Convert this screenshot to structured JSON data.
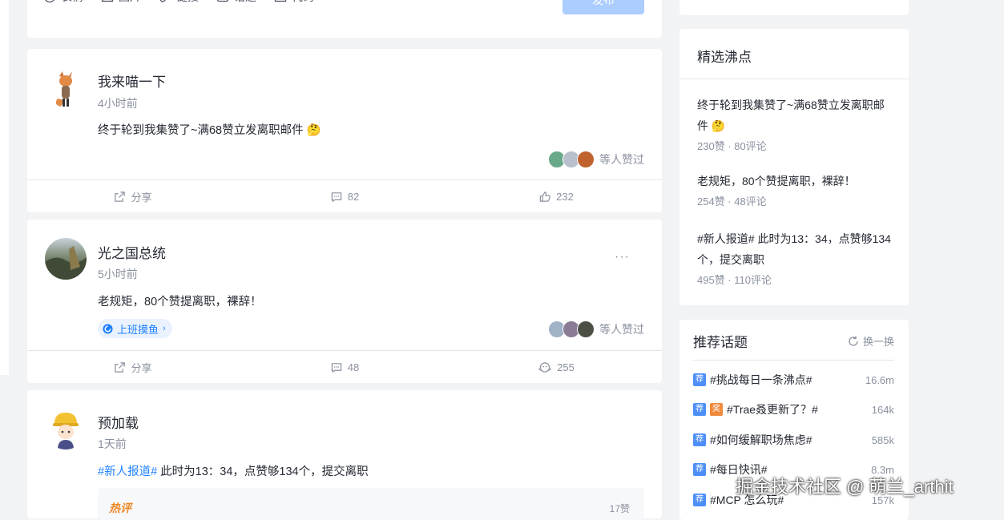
{
  "composer": {
    "tools": [
      "表情",
      "图片",
      "链接",
      "话题",
      "代码"
    ],
    "publish_label": "发布"
  },
  "posts": [
    {
      "author": "我来喵一下",
      "time": "4小时前",
      "content": "终于轮到我集赞了~满68赞立发离职邮件",
      "emoji": "🤔",
      "likers_label": "等人赞过",
      "share_label": "分享",
      "comments": "82",
      "likes": "232"
    },
    {
      "author": "光之国总统",
      "time": "5小时前",
      "content": "老规矩，80个赞提离职，裸辞！",
      "topic": "上班摸鱼",
      "likers_label": "等人赞过",
      "share_label": "分享",
      "comments": "48",
      "likes": "255",
      "more": "···"
    },
    {
      "author": "预加载",
      "time": "1天前",
      "hashtag": "#新人报道#",
      "content": " 此时为13：34，点赞够134个，提交离职",
      "hot_label": "热评",
      "hot_likes": "17赞"
    }
  ],
  "featured": {
    "title": "精选沸点",
    "items": [
      {
        "text": "终于轮到我集赞了~满68赞立发离职邮件",
        "emoji": "🤔",
        "meta": "230赞 · 80评论"
      },
      {
        "text": "老规矩，80个赞提离职，裸辞！",
        "meta": "254赞 · 48评论"
      },
      {
        "text": "#新人报道# 此时为13：34，点赞够134个，提交离职",
        "meta": "495赞 · 110评论"
      }
    ]
  },
  "topics": {
    "title": "推荐话题",
    "refresh_label": "换一换",
    "items": [
      {
        "badge": "荐",
        "name": "#挑战每日一条沸点#",
        "count": "16.6m"
      },
      {
        "badge": "荐",
        "badge2": "奖",
        "name": "#Trae叒更新了？#",
        "count": "164k"
      },
      {
        "badge": "荐",
        "name": "#如何缓解职场焦虑#",
        "count": "585k"
      },
      {
        "badge": "荐",
        "name": "#每日快讯#",
        "count": "8.3m"
      },
      {
        "badge": "荐",
        "name": "#MCP 怎么玩#",
        "count": "157k"
      }
    ]
  },
  "watermark": "掘金技术社区 @ 萌兰_arthit",
  "colors": {
    "brand": "#1e80ff",
    "publish_disabled": "#abcdff",
    "background": "#f2f3f5"
  }
}
